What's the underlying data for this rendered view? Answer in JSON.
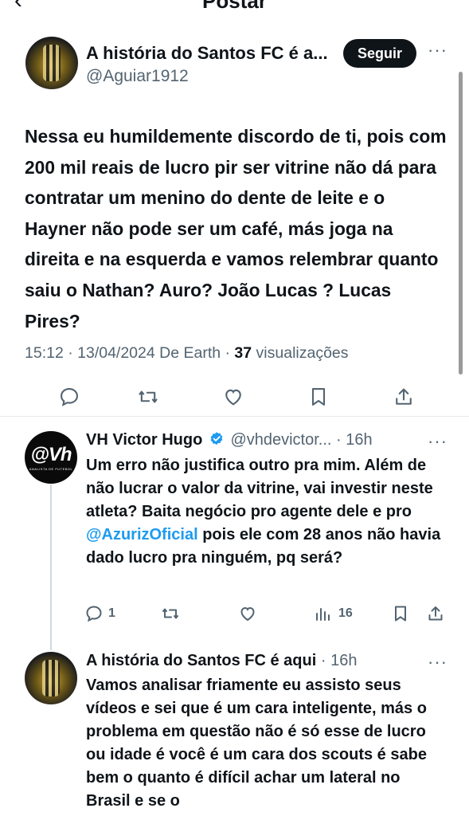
{
  "header": {
    "back_icon": "arrow-left-icon",
    "title": "Postar"
  },
  "main_post": {
    "author_name": "A história do Santos FC é a...",
    "author_handle": "@Aguiar1912",
    "follow_label": "Seguir",
    "more_label": "···",
    "text": "Nessa eu humildemente discordo de ti, pois com 200 mil reais de lucro pir ser vitrine não dá para contratar um menino do dente de leite e o Hayner não pode ser um café, más joga na direita e na esquerda e vamos relembrar quanto saiu o Nathan? Auro? João Lucas ? Lucas Pires?",
    "meta_time": "15:12 · 13/04/2024 De Earth · ",
    "views_count": "37",
    "views_label": " visualizações"
  },
  "replies": [
    {
      "author_name": "VH Victor Hugo",
      "verified": true,
      "handle": "@vhdevictor...",
      "time": " · 16h",
      "text_before_mention": "Um erro não justifica outro pra mim. Além de não lucrar o valor da vitrine, vai investir neste atleta? Baita negócio pro agente dele e pro ",
      "mention": "@AzurizOficial",
      "text_after_mention": " pois ele com 28 anos não havia dado lucro pra ninguém, pq será?",
      "reply_count": "1",
      "views": "16",
      "avatar_logo": "@Vh",
      "avatar_sub": "ANALISTA DE FUTEBOL"
    },
    {
      "author_name": "A história do Santos FC é aqui",
      "time": " · 16h",
      "text": "Vamos analisar friamente eu assisto seus vídeos e sei que é um cara inteligente, más o problema em questão não é só esse de lucro ou idade é você é um cara dos scouts é sabe bem o quanto é difícil achar um lateral no Brasil e se o"
    }
  ],
  "colors": {
    "text": "#0f1419",
    "secondary": "#536471",
    "link": "#1d9bf0",
    "verified": "#1d9bf0",
    "button_bg": "#0f1419"
  }
}
